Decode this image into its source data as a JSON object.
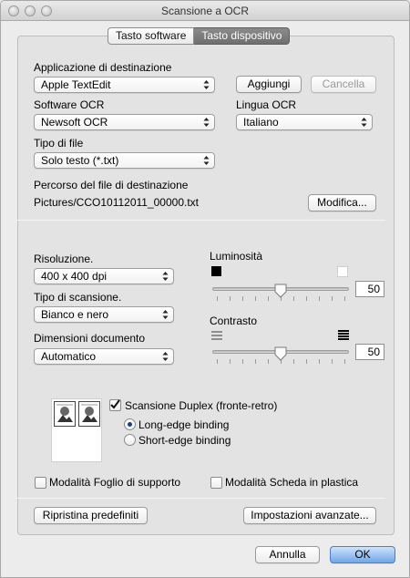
{
  "window": {
    "title": "Scansione a OCR"
  },
  "tabs": [
    {
      "label": "Tasto software",
      "selected": false
    },
    {
      "label": "Tasto dispositivo",
      "selected": true
    }
  ],
  "destination": {
    "label": "Applicazione di destinazione",
    "value": "Apple TextEdit",
    "add_label": "Aggiungi",
    "delete_label": "Cancella"
  },
  "ocr_software": {
    "label": "Software OCR",
    "value": "Newsoft OCR"
  },
  "ocr_language": {
    "label": "Lingua OCR",
    "value": "Italiano"
  },
  "file_type": {
    "label": "Tipo di file",
    "value": "Solo testo (*.txt)"
  },
  "dest_path": {
    "label": "Percorso del file di destinazione",
    "value": "Pictures/CCO10112011_00000.txt",
    "modify_label": "Modifica..."
  },
  "resolution": {
    "label": "Risoluzione.",
    "value": "400 x 400 dpi"
  },
  "scan_type": {
    "label": "Tipo di scansione.",
    "value": "Bianco e nero"
  },
  "doc_size": {
    "label": "Dimensioni documento",
    "value": "Automatico"
  },
  "brightness": {
    "label": "Luminosità",
    "value": "50",
    "level": 0.5
  },
  "contrast": {
    "label": "Contrasto",
    "value": "50",
    "level": 0.5
  },
  "duplex": {
    "label": "Scansione Duplex (fronte-retro)",
    "checked": true,
    "long_edge_label": "Long-edge binding",
    "short_edge_label": "Short-edge binding",
    "selected": "long"
  },
  "carrier_sheet": {
    "label": "Modalità Foglio di supporto",
    "checked": false
  },
  "plastic_card": {
    "label": "Modalità Scheda in plastica",
    "checked": false
  },
  "buttons": {
    "restore_defaults": "Ripristina predefiniti",
    "advanced_settings": "Impostazioni avanzate...",
    "cancel": "Annulla",
    "ok": "OK"
  },
  "colors": {
    "accent": "#6fa6ea",
    "selected_tab": "#7a7a7a"
  }
}
